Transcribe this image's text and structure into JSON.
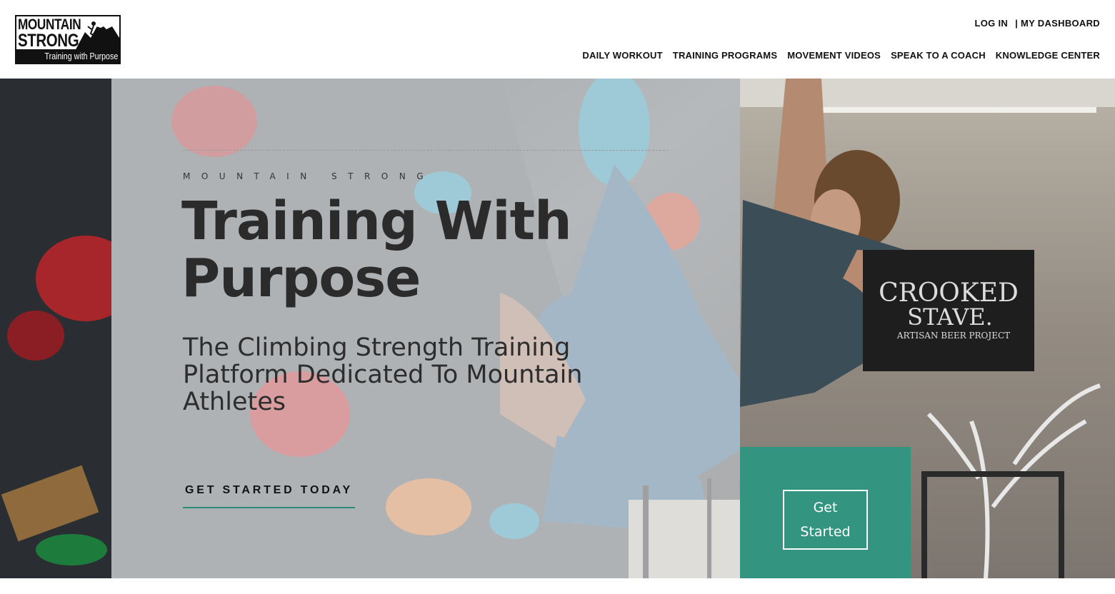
{
  "brand": {
    "logo_line1": "MOUNTAIN",
    "logo_line2": "STRONG",
    "logo_tagline": "Training with Purpose"
  },
  "top_links": {
    "login": "LOG IN",
    "separator": "|",
    "dashboard": "MY DASHBOARD"
  },
  "nav": {
    "items": [
      {
        "label": "DAILY WORKOUT"
      },
      {
        "label": "TRAINING PROGRAMS"
      },
      {
        "label": "MOVEMENT VIDEOS"
      },
      {
        "label": "SPEAK TO A COACH"
      },
      {
        "label": "KNOWLEDGE CENTER"
      }
    ]
  },
  "hero": {
    "eyebrow": "MOUNTAIN STRONG",
    "headline": "Training With Purpose",
    "subhead": "The Climbing Strength Training Platform Dedicated To Mountain Athletes",
    "cta_label": "GET STARTED TODAY",
    "side_button_label": "Get Started",
    "banner_line1": "CROOKED",
    "banner_line2": "STAVE.",
    "banner_line3": "ARTISAN BEER PROJECT"
  },
  "colors": {
    "accent_green": "#33957f",
    "text_dark": "#2b2b2b",
    "overlay": "rgba(228,228,228,0.62)"
  },
  "icons": {
    "logo_mark": "mountain-climber-icon"
  }
}
